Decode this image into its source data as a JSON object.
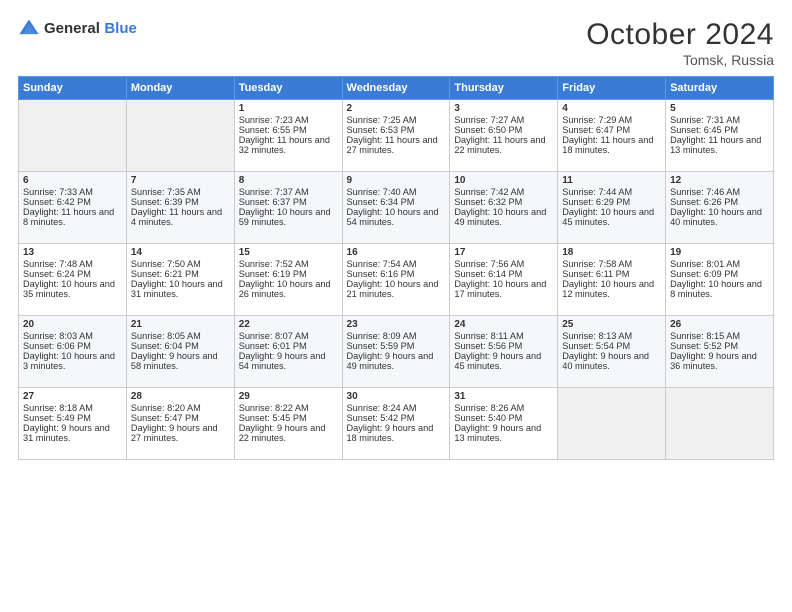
{
  "logo": {
    "general": "General",
    "blue": "Blue"
  },
  "header": {
    "month": "October 2024",
    "location": "Tomsk, Russia"
  },
  "days_of_week": [
    "Sunday",
    "Monday",
    "Tuesday",
    "Wednesday",
    "Thursday",
    "Friday",
    "Saturday"
  ],
  "weeks": [
    [
      {
        "day": "",
        "sunrise": "",
        "sunset": "",
        "daylight": ""
      },
      {
        "day": "",
        "sunrise": "",
        "sunset": "",
        "daylight": ""
      },
      {
        "day": "1",
        "sunrise": "Sunrise: 7:23 AM",
        "sunset": "Sunset: 6:55 PM",
        "daylight": "Daylight: 11 hours and 32 minutes."
      },
      {
        "day": "2",
        "sunrise": "Sunrise: 7:25 AM",
        "sunset": "Sunset: 6:53 PM",
        "daylight": "Daylight: 11 hours and 27 minutes."
      },
      {
        "day": "3",
        "sunrise": "Sunrise: 7:27 AM",
        "sunset": "Sunset: 6:50 PM",
        "daylight": "Daylight: 11 hours and 22 minutes."
      },
      {
        "day": "4",
        "sunrise": "Sunrise: 7:29 AM",
        "sunset": "Sunset: 6:47 PM",
        "daylight": "Daylight: 11 hours and 18 minutes."
      },
      {
        "day": "5",
        "sunrise": "Sunrise: 7:31 AM",
        "sunset": "Sunset: 6:45 PM",
        "daylight": "Daylight: 11 hours and 13 minutes."
      }
    ],
    [
      {
        "day": "6",
        "sunrise": "Sunrise: 7:33 AM",
        "sunset": "Sunset: 6:42 PM",
        "daylight": "Daylight: 11 hours and 8 minutes."
      },
      {
        "day": "7",
        "sunrise": "Sunrise: 7:35 AM",
        "sunset": "Sunset: 6:39 PM",
        "daylight": "Daylight: 11 hours and 4 minutes."
      },
      {
        "day": "8",
        "sunrise": "Sunrise: 7:37 AM",
        "sunset": "Sunset: 6:37 PM",
        "daylight": "Daylight: 10 hours and 59 minutes."
      },
      {
        "day": "9",
        "sunrise": "Sunrise: 7:40 AM",
        "sunset": "Sunset: 6:34 PM",
        "daylight": "Daylight: 10 hours and 54 minutes."
      },
      {
        "day": "10",
        "sunrise": "Sunrise: 7:42 AM",
        "sunset": "Sunset: 6:32 PM",
        "daylight": "Daylight: 10 hours and 49 minutes."
      },
      {
        "day": "11",
        "sunrise": "Sunrise: 7:44 AM",
        "sunset": "Sunset: 6:29 PM",
        "daylight": "Daylight: 10 hours and 45 minutes."
      },
      {
        "day": "12",
        "sunrise": "Sunrise: 7:46 AM",
        "sunset": "Sunset: 6:26 PM",
        "daylight": "Daylight: 10 hours and 40 minutes."
      }
    ],
    [
      {
        "day": "13",
        "sunrise": "Sunrise: 7:48 AM",
        "sunset": "Sunset: 6:24 PM",
        "daylight": "Daylight: 10 hours and 35 minutes."
      },
      {
        "day": "14",
        "sunrise": "Sunrise: 7:50 AM",
        "sunset": "Sunset: 6:21 PM",
        "daylight": "Daylight: 10 hours and 31 minutes."
      },
      {
        "day": "15",
        "sunrise": "Sunrise: 7:52 AM",
        "sunset": "Sunset: 6:19 PM",
        "daylight": "Daylight: 10 hours and 26 minutes."
      },
      {
        "day": "16",
        "sunrise": "Sunrise: 7:54 AM",
        "sunset": "Sunset: 6:16 PM",
        "daylight": "Daylight: 10 hours and 21 minutes."
      },
      {
        "day": "17",
        "sunrise": "Sunrise: 7:56 AM",
        "sunset": "Sunset: 6:14 PM",
        "daylight": "Daylight: 10 hours and 17 minutes."
      },
      {
        "day": "18",
        "sunrise": "Sunrise: 7:58 AM",
        "sunset": "Sunset: 6:11 PM",
        "daylight": "Daylight: 10 hours and 12 minutes."
      },
      {
        "day": "19",
        "sunrise": "Sunrise: 8:01 AM",
        "sunset": "Sunset: 6:09 PM",
        "daylight": "Daylight: 10 hours and 8 minutes."
      }
    ],
    [
      {
        "day": "20",
        "sunrise": "Sunrise: 8:03 AM",
        "sunset": "Sunset: 6:06 PM",
        "daylight": "Daylight: 10 hours and 3 minutes."
      },
      {
        "day": "21",
        "sunrise": "Sunrise: 8:05 AM",
        "sunset": "Sunset: 6:04 PM",
        "daylight": "Daylight: 9 hours and 58 minutes."
      },
      {
        "day": "22",
        "sunrise": "Sunrise: 8:07 AM",
        "sunset": "Sunset: 6:01 PM",
        "daylight": "Daylight: 9 hours and 54 minutes."
      },
      {
        "day": "23",
        "sunrise": "Sunrise: 8:09 AM",
        "sunset": "Sunset: 5:59 PM",
        "daylight": "Daylight: 9 hours and 49 minutes."
      },
      {
        "day": "24",
        "sunrise": "Sunrise: 8:11 AM",
        "sunset": "Sunset: 5:56 PM",
        "daylight": "Daylight: 9 hours and 45 minutes."
      },
      {
        "day": "25",
        "sunrise": "Sunrise: 8:13 AM",
        "sunset": "Sunset: 5:54 PM",
        "daylight": "Daylight: 9 hours and 40 minutes."
      },
      {
        "day": "26",
        "sunrise": "Sunrise: 8:15 AM",
        "sunset": "Sunset: 5:52 PM",
        "daylight": "Daylight: 9 hours and 36 minutes."
      }
    ],
    [
      {
        "day": "27",
        "sunrise": "Sunrise: 8:18 AM",
        "sunset": "Sunset: 5:49 PM",
        "daylight": "Daylight: 9 hours and 31 minutes."
      },
      {
        "day": "28",
        "sunrise": "Sunrise: 8:20 AM",
        "sunset": "Sunset: 5:47 PM",
        "daylight": "Daylight: 9 hours and 27 minutes."
      },
      {
        "day": "29",
        "sunrise": "Sunrise: 8:22 AM",
        "sunset": "Sunset: 5:45 PM",
        "daylight": "Daylight: 9 hours and 22 minutes."
      },
      {
        "day": "30",
        "sunrise": "Sunrise: 8:24 AM",
        "sunset": "Sunset: 5:42 PM",
        "daylight": "Daylight: 9 hours and 18 minutes."
      },
      {
        "day": "31",
        "sunrise": "Sunrise: 8:26 AM",
        "sunset": "Sunset: 5:40 PM",
        "daylight": "Daylight: 9 hours and 13 minutes."
      },
      {
        "day": "",
        "sunrise": "",
        "sunset": "",
        "daylight": ""
      },
      {
        "day": "",
        "sunrise": "",
        "sunset": "",
        "daylight": ""
      }
    ]
  ]
}
